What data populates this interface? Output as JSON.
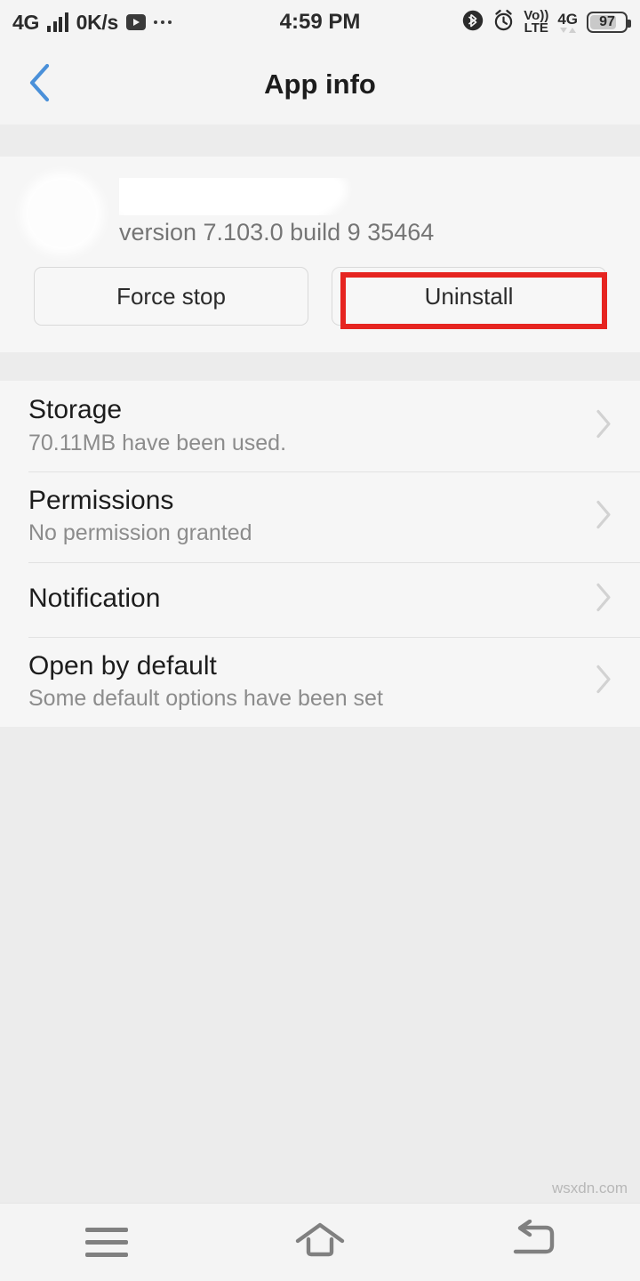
{
  "status_bar": {
    "network_label": "4G",
    "signal_icon": "signal-bars-icon",
    "data_speed": "0K/s",
    "play_icon": "play-badge-icon",
    "overflow_icon": "more-dots-icon",
    "clock": "4:59 PM",
    "bluetooth_icon": "bluetooth-icon",
    "alarm_icon": "alarm-clock-icon",
    "volte_top": "Vo))",
    "volte_bottom": "LTE",
    "network_label_right": "4G",
    "battery_level": "97"
  },
  "title_bar": {
    "back_icon": "back-chevron-icon",
    "title": "App info"
  },
  "app_header": {
    "app_icon": "app-icon-redacted",
    "app_name": "",
    "version": "version 7.103.0 build 9 35464"
  },
  "actions": {
    "force_stop_label": "Force stop",
    "uninstall_label": "Uninstall",
    "highlight_color": "#e62420",
    "highlighted": "uninstall-button"
  },
  "settings_list": [
    {
      "title": "Storage",
      "subtitle": "70.11MB have been used.",
      "chevron": "chevron-right-icon"
    },
    {
      "title": "Permissions",
      "subtitle": "No permission granted",
      "chevron": "chevron-right-icon"
    },
    {
      "title": "Notification",
      "subtitle": "",
      "chevron": "chevron-right-icon"
    },
    {
      "title": "Open by default",
      "subtitle": "Some default options have been set",
      "chevron": "chevron-right-icon"
    }
  ],
  "watermark": "wsxdn.com",
  "nav_bar": {
    "menu_icon": "menu-recents-icon",
    "home_icon": "home-icon",
    "back_icon": "back-arrow-icon"
  },
  "colors": {
    "accent_blue": "#4a90d9",
    "annotation_red": "#e62420",
    "page_bg": "#ececec",
    "card_bg": "#f6f6f6"
  }
}
